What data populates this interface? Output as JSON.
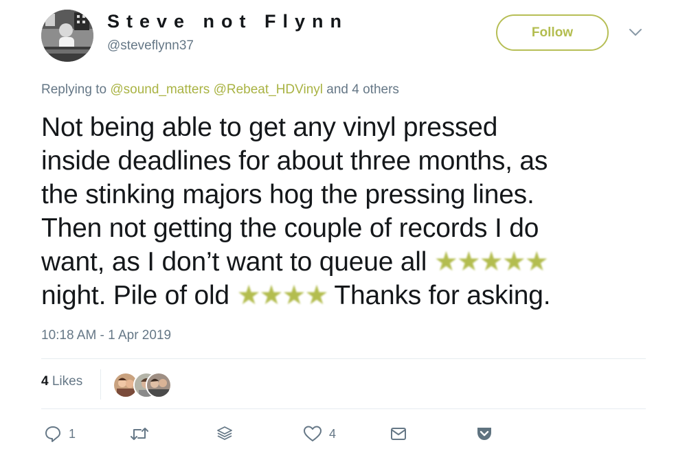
{
  "user": {
    "display_name": "Steve not Flynn",
    "handle": "@steveflynn37"
  },
  "header": {
    "follow_label": "Follow"
  },
  "reply": {
    "prefix": "Replying to",
    "mention_1": "@sound_matters",
    "mention_2": "@Rebeat_HDVinyl",
    "suffix": "and 4 others"
  },
  "tweet": {
    "line_1": "Not being able to get any vinyl pressed",
    "line_2": "inside deadlines for about three months, as",
    "line_3": "the stinking majors hog the pressing lines.",
    "line_4": "Then not getting the couple of records I do",
    "line_5_start": "want, as I don’t want to queue all",
    "censor_1": "★★★★★",
    "line_6_start": "night. Pile of old",
    "censor_2": "★★★★",
    "line_6_end": "Thanks for asking."
  },
  "meta": {
    "timestamp": "10:18 AM - 1 Apr 2019"
  },
  "stats": {
    "likes_count": "4",
    "likes_label": "Likes"
  },
  "actions": {
    "reply_count": "1",
    "like_count": "4"
  },
  "icons": {
    "reply": "reply-icon",
    "retweet": "retweet-icon",
    "layers": "layers-icon",
    "like": "heart-icon",
    "message": "envelope-icon",
    "pocket": "pocket-icon"
  },
  "colors": {
    "accent": "#b3bd4f",
    "secondary_text": "#657786",
    "divider": "#e6ecf0",
    "pocket": "#5f7380"
  }
}
